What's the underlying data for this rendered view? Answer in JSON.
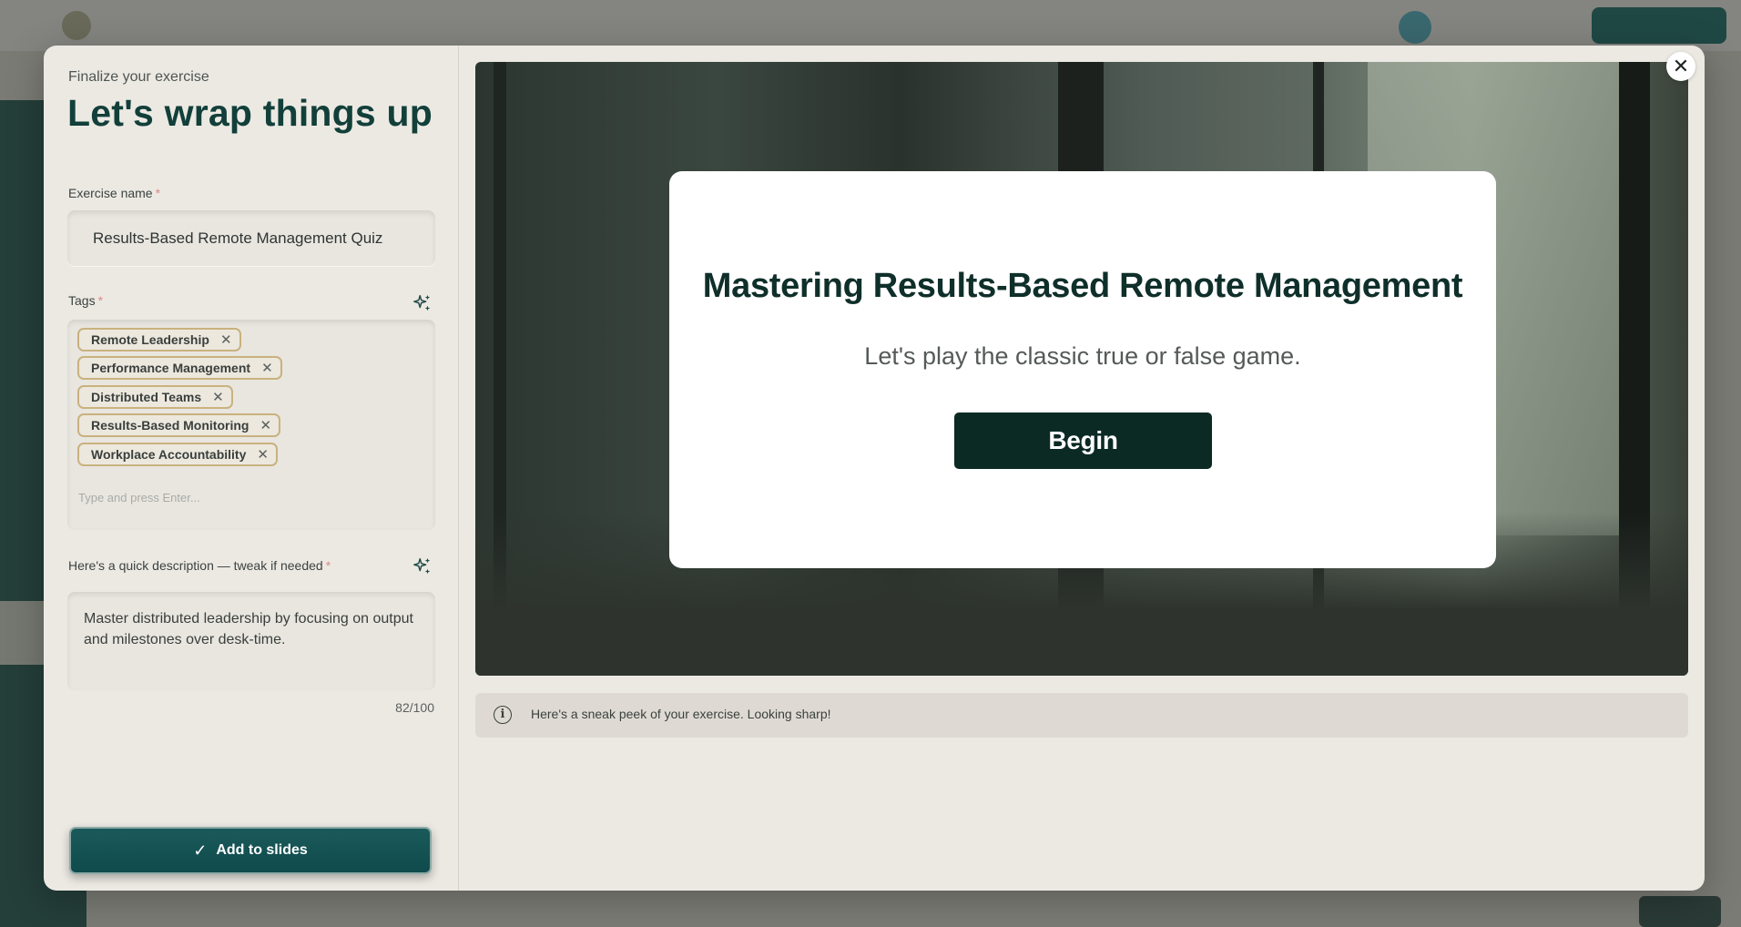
{
  "modal": {
    "kicker": "Finalize your exercise",
    "title": "Let's wrap things up",
    "close_symbol": "✕"
  },
  "exercise_name": {
    "label": "Exercise name",
    "required_mark": "*",
    "value": "Results-Based Remote Management Quiz"
  },
  "tags": {
    "label": "Tags",
    "required_mark": "*",
    "ai_icon": "sparkle-icon",
    "items": [
      {
        "label": "Remote Leadership"
      },
      {
        "label": "Performance Management"
      },
      {
        "label": "Distributed Teams"
      },
      {
        "label": "Results-Based Monitoring"
      },
      {
        "label": "Workplace Accountability"
      }
    ],
    "remove_symbol": "✕",
    "placeholder": "Type and press Enter..."
  },
  "description": {
    "label": "Here's a quick description — tweak if needed",
    "required_mark": "*",
    "ai_icon": "sparkle-icon",
    "value": "Master distributed leadership by focusing on output and milestones over desk-time.",
    "counter": "82/100"
  },
  "actions": {
    "add_label": "Add to slides",
    "add_icon": "check-icon",
    "check_symbol": "✓"
  },
  "preview": {
    "title": "Mastering Results-Based Remote Management",
    "subtitle": "Let's play the classic true or false game.",
    "begin_label": "Begin"
  },
  "info": {
    "icon": "info-icon",
    "icon_symbol": "i",
    "text": "Here's a sneak peek of your exercise. Looking sharp!"
  },
  "colors": {
    "heading": "#123f3a",
    "primary_button": "#0f4a4c",
    "tag_border": "#c9b27e",
    "begin_button": "#0b2a24",
    "modal_bg": "#ece9e3"
  }
}
